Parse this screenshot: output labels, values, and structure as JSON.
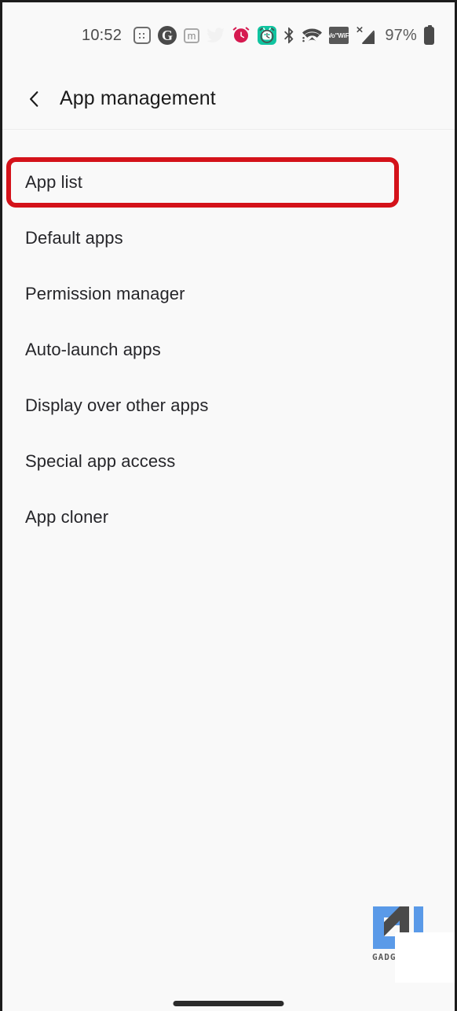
{
  "statusbar": {
    "time": "10:52",
    "battery_percent": "97%",
    "notification_icons": [
      {
        "name": "keypad-icon",
        "label": "keypad"
      },
      {
        "name": "g-circle-icon",
        "label": "G"
      },
      {
        "name": "m-square-icon",
        "label": "m"
      },
      {
        "name": "twitter-bird-icon",
        "label": "twitter"
      },
      {
        "name": "alarm-red-icon",
        "label": "alarm"
      },
      {
        "name": "mi-fit-icon",
        "label": "mi"
      }
    ],
    "system_icons": [
      {
        "name": "alarm-clock-icon",
        "label": "alarm"
      },
      {
        "name": "bluetooth-icon",
        "label": "bluetooth"
      },
      {
        "name": "wifi-icon",
        "label": "wifi"
      },
      {
        "name": "vowifi-icon",
        "label": "VoWiFi"
      },
      {
        "name": "signal-bars-icon",
        "label": "signal"
      },
      {
        "name": "battery-icon",
        "label": "battery"
      }
    ],
    "vowifi_line1": "Vo\"",
    "vowifi_line2": "WiFi",
    "g_glyph": "G",
    "m_glyph": "m"
  },
  "header": {
    "back_label": "‹",
    "title": "App management"
  },
  "list": {
    "items": [
      {
        "label": "App list",
        "highlighted": true
      },
      {
        "label": "Default apps",
        "highlighted": false
      },
      {
        "label": "Permission manager",
        "highlighted": false
      },
      {
        "label": "Auto-launch apps",
        "highlighted": false
      },
      {
        "label": "Display over other apps",
        "highlighted": false
      },
      {
        "label": "Special app access",
        "highlighted": false
      },
      {
        "label": "App cloner",
        "highlighted": false
      }
    ]
  },
  "annotation": {
    "highlight_color": "#d4121a",
    "target": "App list"
  },
  "watermark": {
    "text": "GADG",
    "logo_blue": "#5a9ae8",
    "logo_dark": "#4a4a4a"
  },
  "navbar": {
    "home_indicator": "home-indicator"
  },
  "theme": {
    "background": "#f9f9f9",
    "text_primary": "#26262a",
    "text_header": "#1b1b1b",
    "divider": "#ededed"
  }
}
